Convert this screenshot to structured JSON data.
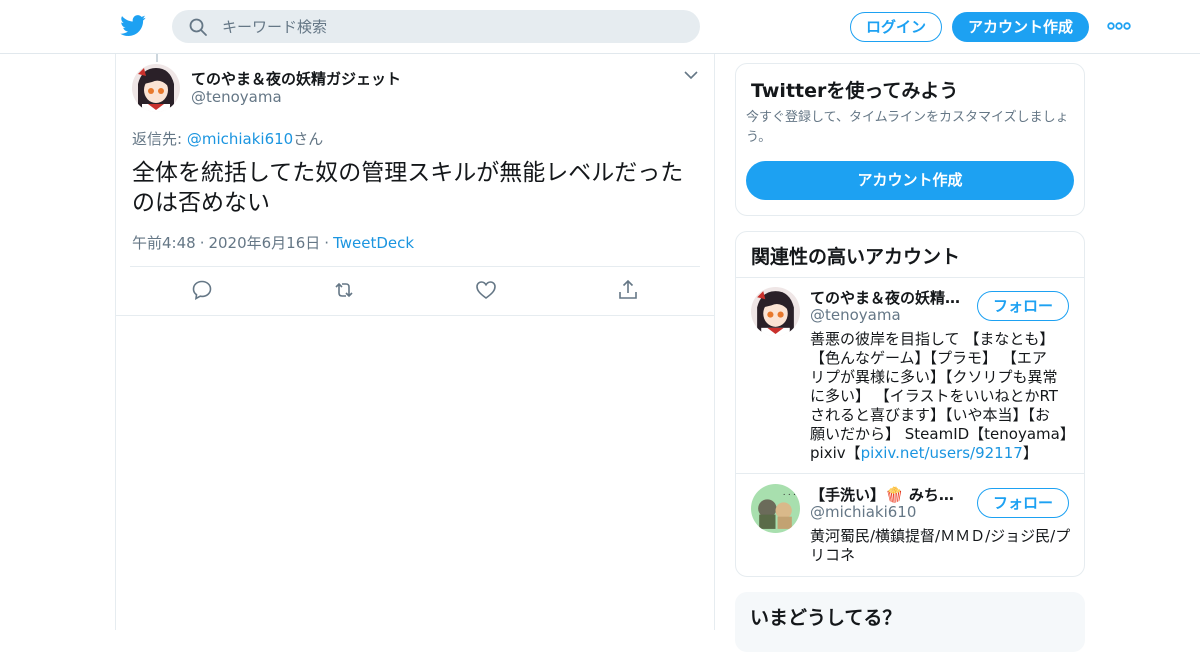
{
  "header": {
    "search_placeholder": "キーワード検索",
    "login_label": "ログイン",
    "signup_label": "アカウント作成"
  },
  "tweet": {
    "display_name": "てのやま＆夜の妖精ガジェット",
    "handle": "@tenoyama",
    "reply_prefix": "返信先: ",
    "reply_mention": "@michiaki610",
    "reply_suffix": "さん",
    "text_line1": "全体を統括してた奴の管理スキルが無能レベルだった",
    "text_line2": "のは否めない",
    "time": "午前4:48",
    "date": "2020年6月16日",
    "source": "TweetDeck",
    "sep": "·"
  },
  "signup_card": {
    "title": "Twitterを使ってみよう",
    "desc_line1": "今すぐ登録して、タイムラインをカスタマイズしましょ",
    "desc_line2": "う。",
    "button": "アカウント作成"
  },
  "related": {
    "title": "関連性の高いアカウント",
    "follow_label": "フォロー",
    "accounts": [
      {
        "name": "てのやま＆夜の妖精…",
        "handle": "@tenoyama",
        "bio_lines": [
          "善悪の彼岸を目指して 【まなとも】",
          "【色んなゲーム】【プラモ】 【エア",
          "リプが異様に多い】【クソリプも異常",
          "に多い】 【イラストをいいねとかRT",
          "されると喜びます】【いや本当】【お",
          "願いだから】 SteamID【tenoyama】"
        ],
        "bio_last_prefix": "pixiv【",
        "bio_link": "pixiv.net/users/92117",
        "bio_last_suffix": "】"
      },
      {
        "name": "【手洗い】🍿 みち…",
        "handle": "@michiaki610",
        "bio_lines": [
          "黄河蜀民/横鎮提督/ＭＭＤ/ジョジ民/プ",
          "リコネ"
        ]
      }
    ]
  },
  "trends": {
    "title": "いまどうしてる？"
  },
  "colors": {
    "brand": "#1da1f2",
    "link": "#1b95e0",
    "muted": "#657786"
  },
  "icons": [
    "twitter-bird-icon",
    "search-icon",
    "more-dots-icon",
    "chevron-down-icon",
    "reply-icon",
    "retweet-icon",
    "like-icon",
    "share-icon"
  ]
}
